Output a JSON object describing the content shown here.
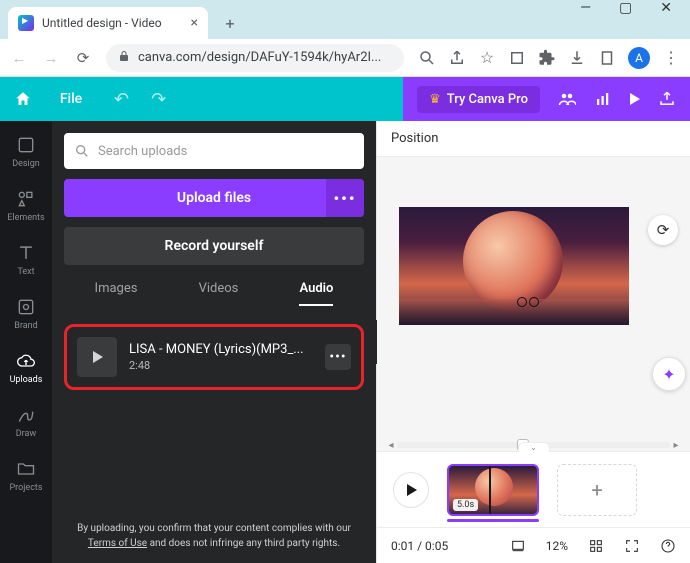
{
  "window": {
    "minimize": "—",
    "maximize": "▢",
    "close": "✕"
  },
  "browser": {
    "tab_title": "Untitled design - Video",
    "url": "canva.com/design/DAFuY-1594k/hyAr2I...",
    "avatar_initial": "A"
  },
  "header": {
    "file_label": "File",
    "try_pro": "Try Canva Pro"
  },
  "rail": {
    "design": "Design",
    "elements": "Elements",
    "text": "Text",
    "brand": "Brand",
    "uploads": "Uploads",
    "draw": "Draw",
    "projects": "Projects"
  },
  "panel": {
    "search_placeholder": "Search uploads",
    "upload_btn": "Upload files",
    "record_btn": "Record yourself",
    "tabs": {
      "images": "Images",
      "videos": "Videos",
      "audio": "Audio"
    },
    "audio_item": {
      "title": "LISA - MONEY (Lyrics)(MP3_...",
      "duration": "2:48"
    },
    "disclaimer_pre": "By uploading, you confirm that your content complies with our ",
    "disclaimer_link": "Terms of Use",
    "disclaimer_post": " and does not infringe any third party rights."
  },
  "canvas": {
    "position_label": "Position",
    "clip_duration": "5.0s"
  },
  "bottom": {
    "time": "0:01 / 0:05",
    "zoom": "12%"
  }
}
